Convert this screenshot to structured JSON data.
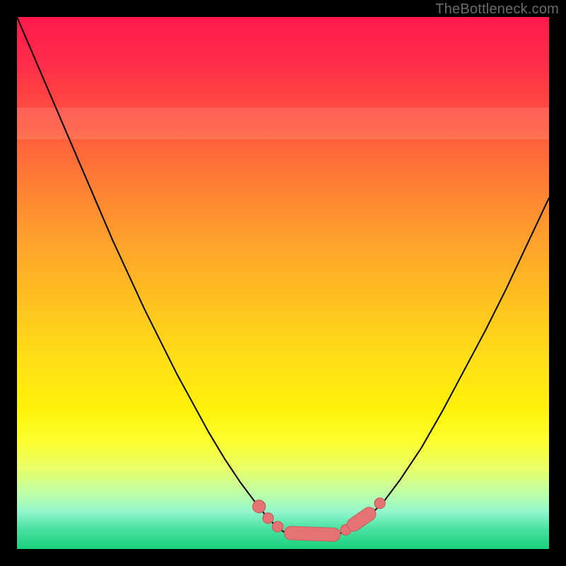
{
  "watermark": "TheBottleneck.com",
  "colors": {
    "page_bg": "#000000",
    "watermark": "#6b6b6b",
    "curve": "#000000",
    "marker_fill": "#e57373",
    "marker_stroke": "#c85a5a"
  },
  "chart_data": {
    "type": "line",
    "title": "",
    "xlabel": "",
    "ylabel": "",
    "xlim": [
      0,
      100
    ],
    "ylim": [
      0,
      100
    ],
    "grid": false,
    "legend": false,
    "background": "rainbow-gradient (red→yellow→green)",
    "series": [
      {
        "name": "left-branch",
        "x": [
          0,
          3,
          6,
          9,
          12,
          15,
          18,
          21,
          24,
          27,
          30,
          33,
          36,
          39,
          42,
          45,
          47,
          49,
          50.5
        ],
        "y": [
          100,
          93,
          86,
          79,
          72,
          65,
          58,
          51.5,
          45,
          39,
          33,
          27.5,
          22,
          17,
          12.5,
          8.5,
          6,
          4,
          3
        ]
      },
      {
        "name": "flat-bottom",
        "x": [
          50.5,
          53,
          56,
          59,
          61
        ],
        "y": [
          3,
          2.6,
          2.5,
          2.6,
          3
        ]
      },
      {
        "name": "right-branch",
        "x": [
          61,
          63,
          66,
          69,
          72,
          76,
          80,
          84,
          88,
          92,
          96,
          100
        ],
        "y": [
          3,
          4,
          6,
          9,
          13,
          19,
          26,
          33.5,
          41,
          49,
          57.5,
          66
        ]
      }
    ],
    "markers": [
      {
        "shape": "circle",
        "x": 45.5,
        "y": 8.0,
        "r": 1.2
      },
      {
        "shape": "circle",
        "x": 47.2,
        "y": 5.8,
        "r": 1.0
      },
      {
        "shape": "circle",
        "x": 49.0,
        "y": 4.2,
        "r": 1.0
      },
      {
        "shape": "capsule",
        "x1": 51.5,
        "y1": 3.0,
        "x2": 59.5,
        "y2": 2.7,
        "r": 1.2
      },
      {
        "shape": "circle",
        "x": 61.8,
        "y": 3.6,
        "r": 1.0
      },
      {
        "shape": "capsule",
        "x1": 63.3,
        "y1": 4.6,
        "x2": 66.2,
        "y2": 6.6,
        "r": 1.2
      },
      {
        "shape": "circle",
        "x": 68.2,
        "y": 8.6,
        "r": 1.0
      }
    ],
    "pale_bands_y": [
      {
        "from": 77,
        "to": 83,
        "alpha": 0.35
      }
    ]
  }
}
